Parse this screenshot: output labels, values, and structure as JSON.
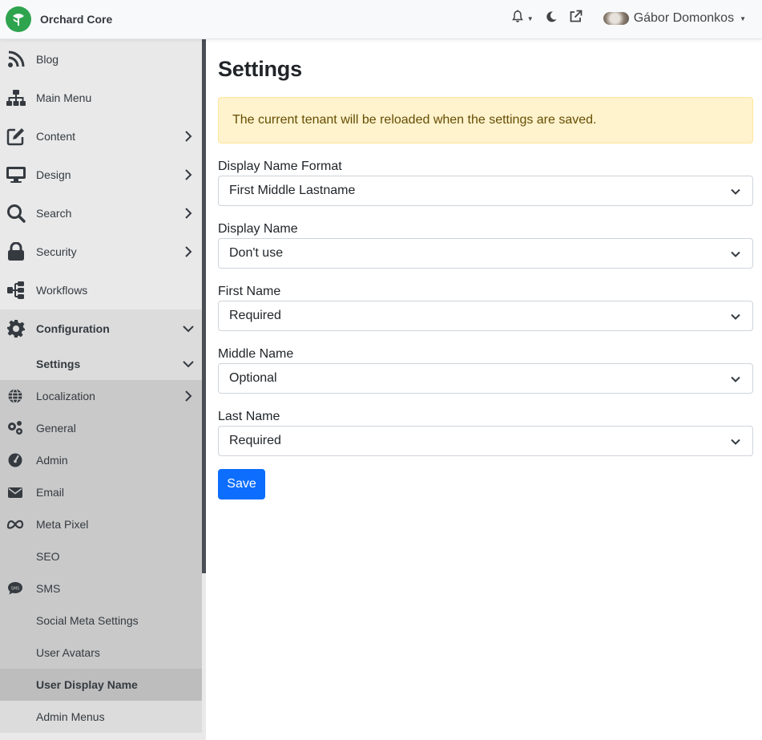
{
  "header": {
    "brand": "Orchard Core",
    "user_name": "Gábor Domonkos",
    "icons": [
      "bell-icon",
      "moon-icon",
      "external-link-icon"
    ]
  },
  "sidebar": {
    "items": [
      {
        "label": "Blog",
        "icon": "rss-icon"
      },
      {
        "label": "Main Menu",
        "icon": "sitemap-icon"
      },
      {
        "label": "Content",
        "icon": "edit-icon"
      },
      {
        "label": "Design",
        "icon": "monitor-icon"
      },
      {
        "label": "Search",
        "icon": "search-icon"
      },
      {
        "label": "Security",
        "icon": "lock-icon"
      },
      {
        "label": "Workflows",
        "icon": "workflow-icon"
      },
      {
        "label": "Configuration",
        "icon": "gear-icon"
      },
      {
        "label": "Settings"
      }
    ],
    "settings_items": [
      {
        "label": "Localization",
        "icon": "globe-icon"
      },
      {
        "label": "General",
        "icon": "gears-icon"
      },
      {
        "label": "Admin",
        "icon": "gauge-icon"
      },
      {
        "label": "Email",
        "icon": "envelope-icon"
      },
      {
        "label": "Meta Pixel",
        "icon": "meta-icon"
      },
      {
        "label": "SEO"
      },
      {
        "label": "SMS",
        "icon": "sms-icon"
      },
      {
        "label": "Social Meta Settings"
      },
      {
        "label": "User Avatars"
      },
      {
        "label": "User Display Name"
      },
      {
        "label": "Admin Menus"
      }
    ]
  },
  "main": {
    "title": "Settings",
    "alert": "The current tenant will be reloaded when the settings are saved.",
    "fields": [
      {
        "label": "Display Name Format",
        "value": "First Middle Lastname"
      },
      {
        "label": "Display Name",
        "value": "Don't use"
      },
      {
        "label": "First Name",
        "value": "Required"
      },
      {
        "label": "Middle Name",
        "value": "Optional"
      },
      {
        "label": "Last Name",
        "value": "Required"
      }
    ],
    "save_label": "Save"
  },
  "colors": {
    "accent": "#0d6efd",
    "brand": "#2ea44f",
    "alert_bg": "#fff3cd"
  }
}
